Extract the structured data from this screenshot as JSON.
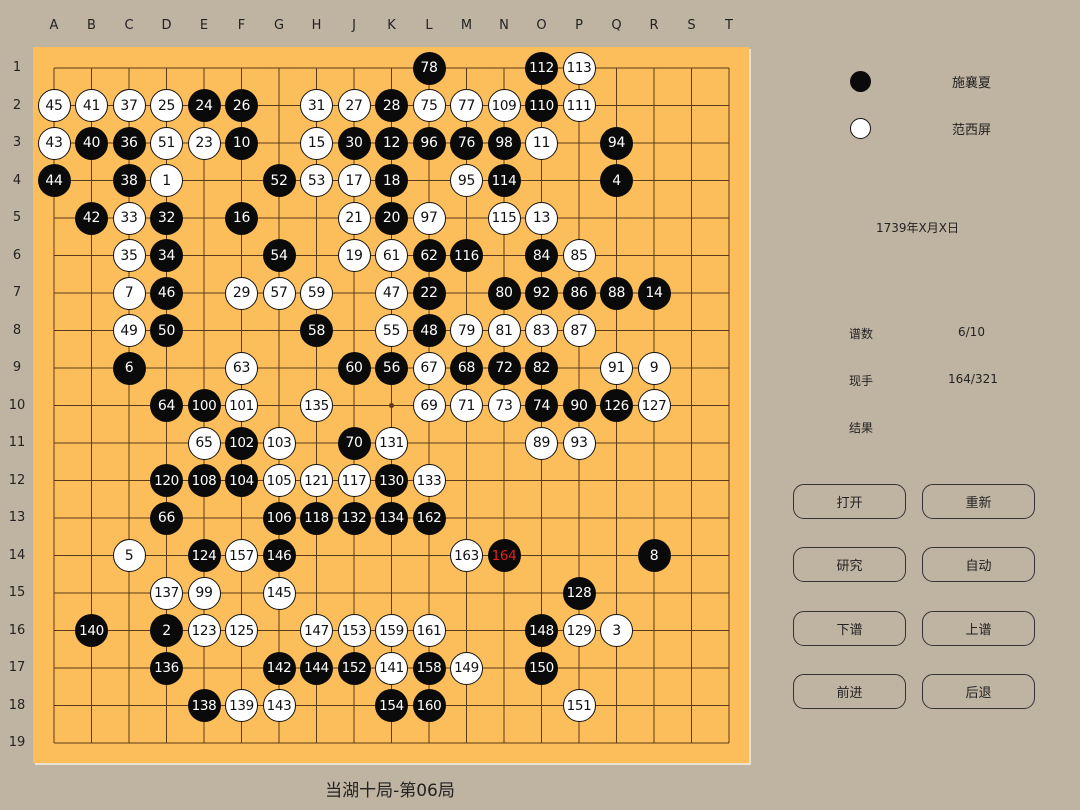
{
  "columns": [
    "A",
    "B",
    "C",
    "D",
    "E",
    "F",
    "G",
    "H",
    "J",
    "K",
    "L",
    "M",
    "N",
    "O",
    "P",
    "Q",
    "R",
    "S",
    "T"
  ],
  "rows": [
    "1",
    "2",
    "3",
    "4",
    "5",
    "6",
    "7",
    "8",
    "9",
    "10",
    "11",
    "12",
    "13",
    "14",
    "15",
    "16",
    "17",
    "18",
    "19"
  ],
  "colors": {
    "board": "#fcbe5a",
    "background": "#bfb4a2",
    "last_move": "#e0241b"
  },
  "players": {
    "black": {
      "name": "施襄夏",
      "icon": "black-stone-icon"
    },
    "white": {
      "name": "范西屏",
      "icon": "white-stone-icon"
    }
  },
  "date": "1739年X月X日",
  "info": {
    "record_label": "谱数",
    "record_value": "6/10",
    "move_label": "现手",
    "move_value": "164/321",
    "result_label": "结果",
    "result_value": ""
  },
  "buttons": {
    "open": "打开",
    "new": "重新",
    "research": "研究",
    "auto": "自动",
    "next_record": "下谱",
    "prev_record": "上谱",
    "forward": "前进",
    "back": "后退"
  },
  "game_title": "当湖十局-第06局",
  "stones": [
    {
      "c": 10,
      "r": 0,
      "n": "78",
      "color": "b"
    },
    {
      "c": 13,
      "r": 0,
      "n": "112",
      "color": "b"
    },
    {
      "c": 14,
      "r": 0,
      "n": "113",
      "color": "w"
    },
    {
      "c": 0,
      "r": 1,
      "n": "45",
      "color": "w"
    },
    {
      "c": 1,
      "r": 1,
      "n": "41",
      "color": "w"
    },
    {
      "c": 2,
      "r": 1,
      "n": "37",
      "color": "w"
    },
    {
      "c": 3,
      "r": 1,
      "n": "25",
      "color": "w"
    },
    {
      "c": 4,
      "r": 1,
      "n": "24",
      "color": "b"
    },
    {
      "c": 5,
      "r": 1,
      "n": "26",
      "color": "b"
    },
    {
      "c": 7,
      "r": 1,
      "n": "31",
      "color": "w"
    },
    {
      "c": 8,
      "r": 1,
      "n": "27",
      "color": "w"
    },
    {
      "c": 9,
      "r": 1,
      "n": "28",
      "color": "b"
    },
    {
      "c": 10,
      "r": 1,
      "n": "75",
      "color": "w"
    },
    {
      "c": 11,
      "r": 1,
      "n": "77",
      "color": "w"
    },
    {
      "c": 12,
      "r": 1,
      "n": "109",
      "color": "w"
    },
    {
      "c": 13,
      "r": 1,
      "n": "110",
      "color": "b"
    },
    {
      "c": 14,
      "r": 1,
      "n": "111",
      "color": "w"
    },
    {
      "c": 0,
      "r": 2,
      "n": "43",
      "color": "w"
    },
    {
      "c": 1,
      "r": 2,
      "n": "40",
      "color": "b"
    },
    {
      "c": 2,
      "r": 2,
      "n": "36",
      "color": "b"
    },
    {
      "c": 3,
      "r": 2,
      "n": "51",
      "color": "w"
    },
    {
      "c": 4,
      "r": 2,
      "n": "23",
      "color": "w"
    },
    {
      "c": 5,
      "r": 2,
      "n": "10",
      "color": "b"
    },
    {
      "c": 7,
      "r": 2,
      "n": "15",
      "color": "w"
    },
    {
      "c": 8,
      "r": 2,
      "n": "30",
      "color": "b"
    },
    {
      "c": 9,
      "r": 2,
      "n": "12",
      "color": "b"
    },
    {
      "c": 10,
      "r": 2,
      "n": "96",
      "color": "b"
    },
    {
      "c": 11,
      "r": 2,
      "n": "76",
      "color": "b"
    },
    {
      "c": 12,
      "r": 2,
      "n": "98",
      "color": "b"
    },
    {
      "c": 13,
      "r": 2,
      "n": "11",
      "color": "w"
    },
    {
      "c": 15,
      "r": 2,
      "n": "94",
      "color": "b"
    },
    {
      "c": 0,
      "r": 3,
      "n": "44",
      "color": "b"
    },
    {
      "c": 2,
      "r": 3,
      "n": "38",
      "color": "b"
    },
    {
      "c": 3,
      "r": 3,
      "n": "1",
      "color": "w"
    },
    {
      "c": 6,
      "r": 3,
      "n": "52",
      "color": "b"
    },
    {
      "c": 7,
      "r": 3,
      "n": "53",
      "color": "w"
    },
    {
      "c": 8,
      "r": 3,
      "n": "17",
      "color": "w"
    },
    {
      "c": 9,
      "r": 3,
      "n": "18",
      "color": "b"
    },
    {
      "c": 11,
      "r": 3,
      "n": "95",
      "color": "w"
    },
    {
      "c": 12,
      "r": 3,
      "n": "114",
      "color": "b"
    },
    {
      "c": 15,
      "r": 3,
      "n": "4",
      "color": "b"
    },
    {
      "c": 1,
      "r": 4,
      "n": "42",
      "color": "b"
    },
    {
      "c": 2,
      "r": 4,
      "n": "33",
      "color": "w"
    },
    {
      "c": 3,
      "r": 4,
      "n": "32",
      "color": "b"
    },
    {
      "c": 5,
      "r": 4,
      "n": "16",
      "color": "b"
    },
    {
      "c": 8,
      "r": 4,
      "n": "21",
      "color": "w"
    },
    {
      "c": 9,
      "r": 4,
      "n": "20",
      "color": "b"
    },
    {
      "c": 10,
      "r": 4,
      "n": "97",
      "color": "w"
    },
    {
      "c": 12,
      "r": 4,
      "n": "115",
      "color": "w"
    },
    {
      "c": 13,
      "r": 4,
      "n": "13",
      "color": "w"
    },
    {
      "c": 2,
      "r": 5,
      "n": "35",
      "color": "w"
    },
    {
      "c": 3,
      "r": 5,
      "n": "34",
      "color": "b"
    },
    {
      "c": 6,
      "r": 5,
      "n": "54",
      "color": "b"
    },
    {
      "c": 8,
      "r": 5,
      "n": "19",
      "color": "w"
    },
    {
      "c": 9,
      "r": 5,
      "n": "61",
      "color": "w"
    },
    {
      "c": 10,
      "r": 5,
      "n": "62",
      "color": "b"
    },
    {
      "c": 11,
      "r": 5,
      "n": "116",
      "color": "b"
    },
    {
      "c": 13,
      "r": 5,
      "n": "84",
      "color": "b"
    },
    {
      "c": 14,
      "r": 5,
      "n": "85",
      "color": "w"
    },
    {
      "c": 2,
      "r": 6,
      "n": "7",
      "color": "w"
    },
    {
      "c": 3,
      "r": 6,
      "n": "46",
      "color": "b"
    },
    {
      "c": 5,
      "r": 6,
      "n": "29",
      "color": "w"
    },
    {
      "c": 6,
      "r": 6,
      "n": "57",
      "color": "w"
    },
    {
      "c": 7,
      "r": 6,
      "n": "59",
      "color": "w"
    },
    {
      "c": 9,
      "r": 6,
      "n": "47",
      "color": "w"
    },
    {
      "c": 10,
      "r": 6,
      "n": "22",
      "color": "b"
    },
    {
      "c": 12,
      "r": 6,
      "n": "80",
      "color": "b"
    },
    {
      "c": 13,
      "r": 6,
      "n": "92",
      "color": "b"
    },
    {
      "c": 14,
      "r": 6,
      "n": "86",
      "color": "b"
    },
    {
      "c": 15,
      "r": 6,
      "n": "88",
      "color": "b"
    },
    {
      "c": 16,
      "r": 6,
      "n": "14",
      "color": "b"
    },
    {
      "c": 2,
      "r": 7,
      "n": "49",
      "color": "w"
    },
    {
      "c": 3,
      "r": 7,
      "n": "50",
      "color": "b"
    },
    {
      "c": 7,
      "r": 7,
      "n": "58",
      "color": "b"
    },
    {
      "c": 9,
      "r": 7,
      "n": "55",
      "color": "w"
    },
    {
      "c": 10,
      "r": 7,
      "n": "48",
      "color": "b"
    },
    {
      "c": 11,
      "r": 7,
      "n": "79",
      "color": "w"
    },
    {
      "c": 12,
      "r": 7,
      "n": "81",
      "color": "w"
    },
    {
      "c": 13,
      "r": 7,
      "n": "83",
      "color": "w"
    },
    {
      "c": 14,
      "r": 7,
      "n": "87",
      "color": "w"
    },
    {
      "c": 2,
      "r": 8,
      "n": "6",
      "color": "b"
    },
    {
      "c": 5,
      "r": 8,
      "n": "63",
      "color": "w"
    },
    {
      "c": 8,
      "r": 8,
      "n": "60",
      "color": "b"
    },
    {
      "c": 9,
      "r": 8,
      "n": "56",
      "color": "b"
    },
    {
      "c": 10,
      "r": 8,
      "n": "67",
      "color": "w"
    },
    {
      "c": 11,
      "r": 8,
      "n": "68",
      "color": "b"
    },
    {
      "c": 12,
      "r": 8,
      "n": "72",
      "color": "b"
    },
    {
      "c": 13,
      "r": 8,
      "n": "82",
      "color": "b"
    },
    {
      "c": 15,
      "r": 8,
      "n": "91",
      "color": "w"
    },
    {
      "c": 16,
      "r": 8,
      "n": "9",
      "color": "w"
    },
    {
      "c": 3,
      "r": 9,
      "n": "64",
      "color": "b"
    },
    {
      "c": 4,
      "r": 9,
      "n": "100",
      "color": "b"
    },
    {
      "c": 5,
      "r": 9,
      "n": "101",
      "color": "w"
    },
    {
      "c": 7,
      "r": 9,
      "n": "135",
      "color": "w"
    },
    {
      "c": 10,
      "r": 9,
      "n": "69",
      "color": "w"
    },
    {
      "c": 11,
      "r": 9,
      "n": "71",
      "color": "w"
    },
    {
      "c": 12,
      "r": 9,
      "n": "73",
      "color": "w"
    },
    {
      "c": 13,
      "r": 9,
      "n": "74",
      "color": "b"
    },
    {
      "c": 14,
      "r": 9,
      "n": "90",
      "color": "b"
    },
    {
      "c": 15,
      "r": 9,
      "n": "126",
      "color": "b"
    },
    {
      "c": 16,
      "r": 9,
      "n": "127",
      "color": "w"
    },
    {
      "c": 4,
      "r": 10,
      "n": "65",
      "color": "w"
    },
    {
      "c": 5,
      "r": 10,
      "n": "102",
      "color": "b"
    },
    {
      "c": 6,
      "r": 10,
      "n": "103",
      "color": "w"
    },
    {
      "c": 8,
      "r": 10,
      "n": "70",
      "color": "b"
    },
    {
      "c": 9,
      "r": 10,
      "n": "131",
      "color": "w"
    },
    {
      "c": 13,
      "r": 10,
      "n": "89",
      "color": "w"
    },
    {
      "c": 14,
      "r": 10,
      "n": "93",
      "color": "w"
    },
    {
      "c": 3,
      "r": 11,
      "n": "120",
      "color": "b"
    },
    {
      "c": 4,
      "r": 11,
      "n": "108",
      "color": "b"
    },
    {
      "c": 5,
      "r": 11,
      "n": "104",
      "color": "b"
    },
    {
      "c": 6,
      "r": 11,
      "n": "105",
      "color": "w"
    },
    {
      "c": 7,
      "r": 11,
      "n": "121",
      "color": "w"
    },
    {
      "c": 8,
      "r": 11,
      "n": "117",
      "color": "w"
    },
    {
      "c": 9,
      "r": 11,
      "n": "130",
      "color": "b"
    },
    {
      "c": 10,
      "r": 11,
      "n": "133",
      "color": "w"
    },
    {
      "c": 3,
      "r": 12,
      "n": "66",
      "color": "b"
    },
    {
      "c": 6,
      "r": 12,
      "n": "106",
      "color": "b"
    },
    {
      "c": 7,
      "r": 12,
      "n": "118",
      "color": "b"
    },
    {
      "c": 8,
      "r": 12,
      "n": "132",
      "color": "b"
    },
    {
      "c": 9,
      "r": 12,
      "n": "134",
      "color": "b"
    },
    {
      "c": 10,
      "r": 12,
      "n": "162",
      "color": "b"
    },
    {
      "c": 2,
      "r": 13,
      "n": "5",
      "color": "w"
    },
    {
      "c": 4,
      "r": 13,
      "n": "124",
      "color": "b"
    },
    {
      "c": 5,
      "r": 13,
      "n": "157",
      "color": "w"
    },
    {
      "c": 6,
      "r": 13,
      "n": "146",
      "color": "b"
    },
    {
      "c": 11,
      "r": 13,
      "n": "163",
      "color": "w"
    },
    {
      "c": 12,
      "r": 13,
      "n": "164",
      "color": "b",
      "last": true
    },
    {
      "c": 16,
      "r": 13,
      "n": "8",
      "color": "b"
    },
    {
      "c": 3,
      "r": 14,
      "n": "137",
      "color": "w"
    },
    {
      "c": 4,
      "r": 14,
      "n": "99",
      "color": "w"
    },
    {
      "c": 6,
      "r": 14,
      "n": "145",
      "color": "w"
    },
    {
      "c": 14,
      "r": 14,
      "n": "128",
      "color": "b"
    },
    {
      "c": 1,
      "r": 15,
      "n": "140",
      "color": "b"
    },
    {
      "c": 3,
      "r": 15,
      "n": "2",
      "color": "b"
    },
    {
      "c": 4,
      "r": 15,
      "n": "123",
      "color": "w"
    },
    {
      "c": 5,
      "r": 15,
      "n": "125",
      "color": "w"
    },
    {
      "c": 7,
      "r": 15,
      "n": "147",
      "color": "w"
    },
    {
      "c": 8,
      "r": 15,
      "n": "153",
      "color": "w"
    },
    {
      "c": 9,
      "r": 15,
      "n": "159",
      "color": "w"
    },
    {
      "c": 10,
      "r": 15,
      "n": "161",
      "color": "w"
    },
    {
      "c": 13,
      "r": 15,
      "n": "148",
      "color": "b"
    },
    {
      "c": 14,
      "r": 15,
      "n": "129",
      "color": "w"
    },
    {
      "c": 15,
      "r": 15,
      "n": "3",
      "color": "w"
    },
    {
      "c": 3,
      "r": 16,
      "n": "136",
      "color": "b"
    },
    {
      "c": 6,
      "r": 16,
      "n": "142",
      "color": "b"
    },
    {
      "c": 7,
      "r": 16,
      "n": "144",
      "color": "b"
    },
    {
      "c": 8,
      "r": 16,
      "n": "152",
      "color": "b"
    },
    {
      "c": 9,
      "r": 16,
      "n": "141",
      "color": "w"
    },
    {
      "c": 10,
      "r": 16,
      "n": "158",
      "color": "b"
    },
    {
      "c": 11,
      "r": 16,
      "n": "149",
      "color": "w"
    },
    {
      "c": 13,
      "r": 16,
      "n": "150",
      "color": "b"
    },
    {
      "c": 4,
      "r": 17,
      "n": "138",
      "color": "b"
    },
    {
      "c": 5,
      "r": 17,
      "n": "139",
      "color": "w"
    },
    {
      "c": 6,
      "r": 17,
      "n": "143",
      "color": "w"
    },
    {
      "c": 9,
      "r": 17,
      "n": "154",
      "color": "b"
    },
    {
      "c": 10,
      "r": 17,
      "n": "160",
      "color": "b"
    },
    {
      "c": 14,
      "r": 17,
      "n": "151",
      "color": "w"
    }
  ]
}
